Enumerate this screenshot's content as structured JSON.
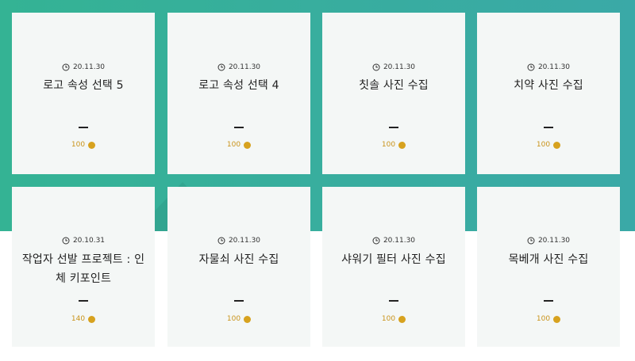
{
  "colors": {
    "band": "#38ad9f",
    "card": "#f4f7f6",
    "coin": "#d7a21f",
    "points_text": "#c9931a"
  },
  "icons": {
    "date": "clock-icon",
    "points": "coin-icon"
  },
  "cards": [
    {
      "date": "20.11.30",
      "title": "로고 속성 선택 5",
      "points": "100"
    },
    {
      "date": "20.11.30",
      "title": "로고 속성 선택 4",
      "points": "100"
    },
    {
      "date": "20.11.30",
      "title": "칫솔 사진 수집",
      "points": "100"
    },
    {
      "date": "20.11.30",
      "title": "치약 사진 수집",
      "points": "100"
    },
    {
      "date": "20.10.31",
      "title": "작업자 선발 프로젝트 : 인체 키포인트",
      "points": "140"
    },
    {
      "date": "20.11.30",
      "title": "자물쇠 사진 수집",
      "points": "100"
    },
    {
      "date": "20.11.30",
      "title": "샤워기 필터 사진 수집",
      "points": "100"
    },
    {
      "date": "20.11.30",
      "title": "목베개 사진 수집",
      "points": "100"
    }
  ]
}
